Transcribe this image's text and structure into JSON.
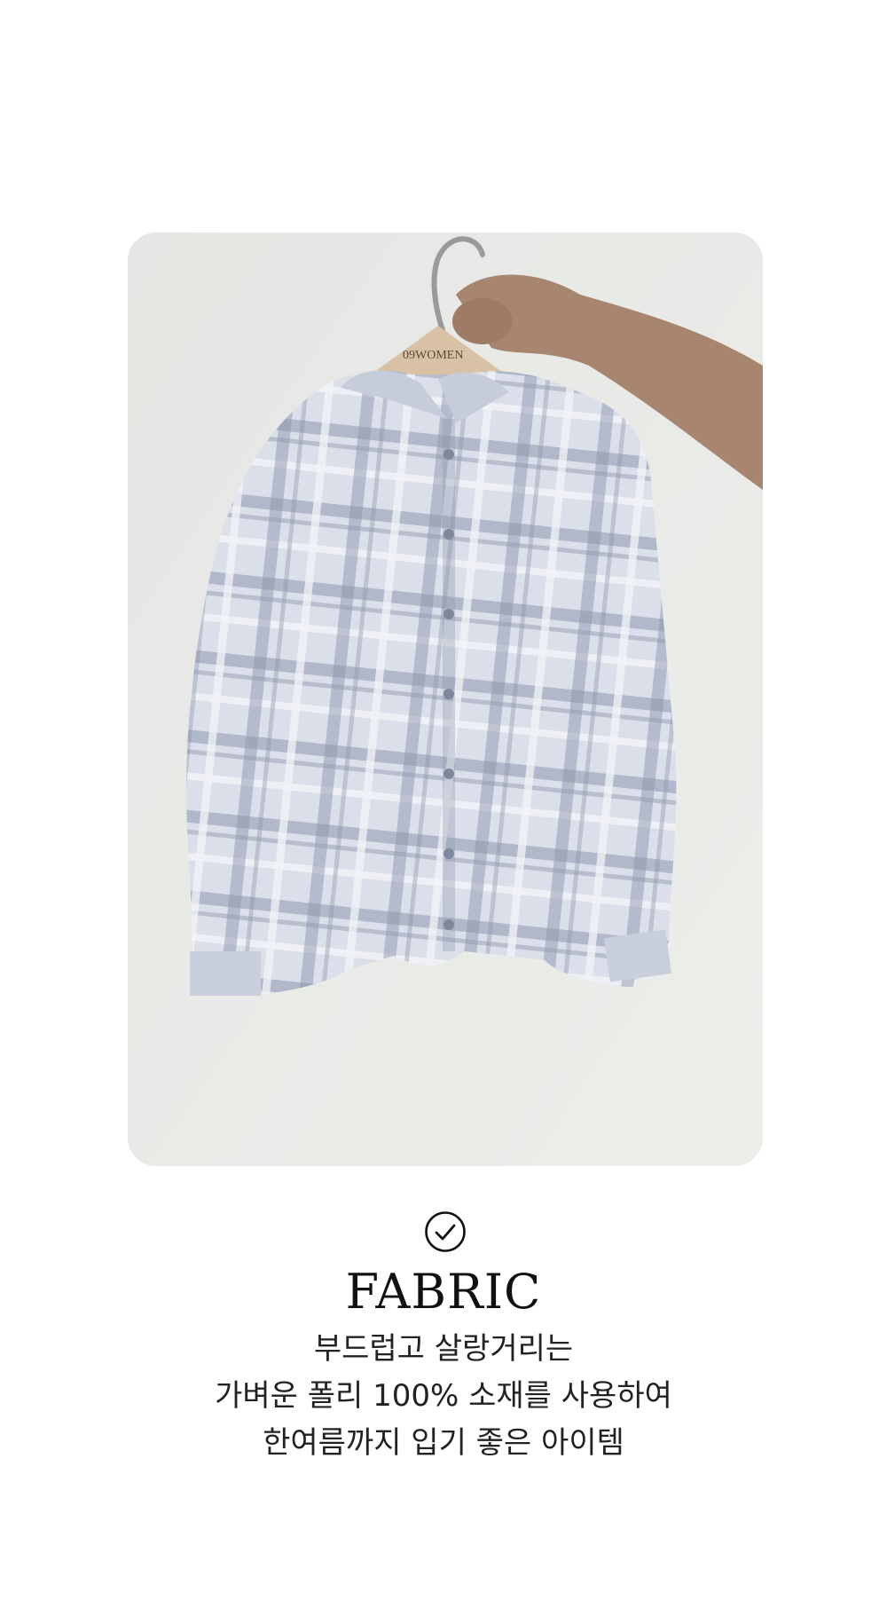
{
  "product_photo": {
    "hanger_brand": "09WOMEN",
    "colors": {
      "background": "#e8e9e6",
      "shirt_base": "#d7dce8",
      "check_stripe": "#8e97ad",
      "hanger_wood": "#d9c1a5"
    }
  },
  "feature": {
    "icon": "check-circle-icon",
    "title": "FABRIC",
    "description_lines": [
      "부드럽고 살랑거리는",
      "가벼운 폴리 100% 소재를 사용하여",
      "한여름까지 입기 좋은 아이템"
    ]
  }
}
